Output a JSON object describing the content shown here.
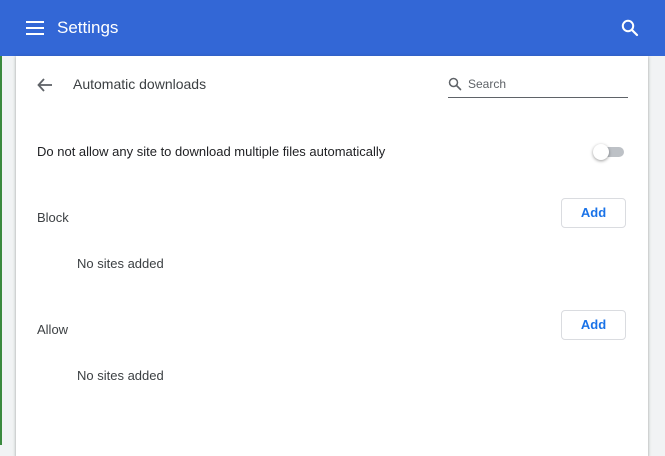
{
  "app": {
    "title": "Settings",
    "menu_icon": "hamburger-menu-icon",
    "search_icon": "search-icon",
    "header_color": "#3367d6"
  },
  "page": {
    "title": "Automatic downloads",
    "back_icon": "arrow-back-icon",
    "search": {
      "placeholder": "Search",
      "value": ""
    }
  },
  "main_setting": {
    "label": "Do not allow any site to download multiple files automatically",
    "toggle_on": false
  },
  "sections": {
    "block": {
      "label": "Block",
      "add_label": "Add",
      "empty_text": "No sites added"
    },
    "allow": {
      "label": "Allow",
      "add_label": "Add",
      "empty_text": "No sites added"
    }
  },
  "colors": {
    "accent": "#1a73e8",
    "toggle_off_track": "#bdc1c6"
  }
}
